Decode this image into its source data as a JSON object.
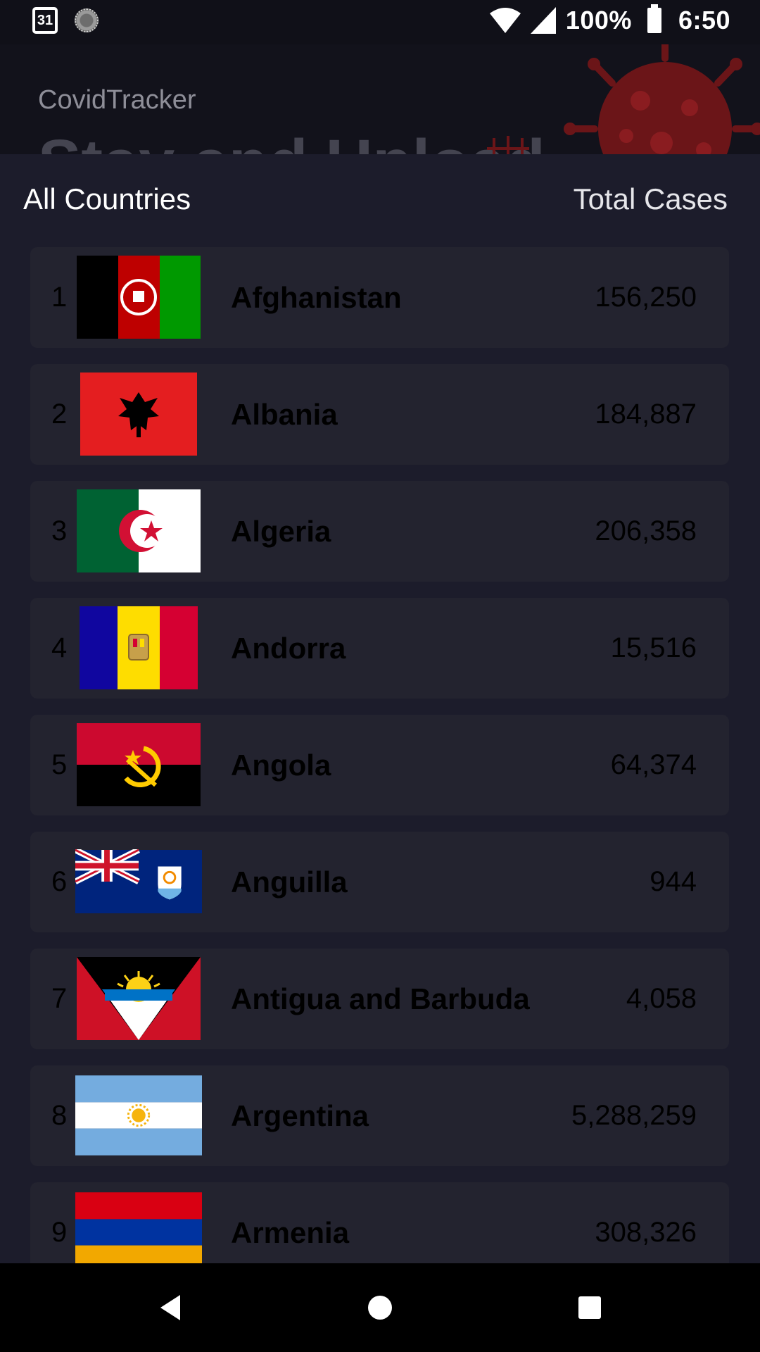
{
  "status_bar": {
    "calendar_day": "31",
    "battery_percent": "100%",
    "time": "6:50",
    "icons": [
      "calendar-icon",
      "sync-spinner-icon",
      "wifi-icon",
      "cell-signal-icon",
      "battery-icon"
    ]
  },
  "header": {
    "app_name": "CovidTracker",
    "background_title": "Stay and Upload",
    "decorations": [
      "virus-icon"
    ]
  },
  "list_header": {
    "left_label": "All Countries",
    "right_label": "Total Cases"
  },
  "countries": [
    {
      "rank": "1",
      "name": "Afghanistan",
      "cases": "156,250",
      "flag": "afghanistan-flag-icon"
    },
    {
      "rank": "2",
      "name": "Albania",
      "cases": "184,887",
      "flag": "albania-flag-icon"
    },
    {
      "rank": "3",
      "name": "Algeria",
      "cases": "206,358",
      "flag": "algeria-flag-icon"
    },
    {
      "rank": "4",
      "name": "Andorra",
      "cases": "15,516",
      "flag": "andorra-flag-icon"
    },
    {
      "rank": "5",
      "name": "Angola",
      "cases": "64,374",
      "flag": "angola-flag-icon"
    },
    {
      "rank": "6",
      "name": "Anguilla",
      "cases": "944",
      "flag": "anguilla-flag-icon"
    },
    {
      "rank": "7",
      "name": "Antigua and Barbuda",
      "cases": "4,058",
      "flag": "antigua-and-barbuda-flag-icon"
    },
    {
      "rank": "8",
      "name": "Argentina",
      "cases": "5,288,259",
      "flag": "argentina-flag-icon"
    },
    {
      "rank": "9",
      "name": "Armenia",
      "cases": "308,326",
      "flag": "armenia-flag-icon"
    }
  ],
  "nav_bar": {
    "icons": [
      "back-icon",
      "home-icon",
      "recents-icon"
    ]
  },
  "colors": {
    "panel_bg": "#1c1c2b",
    "row_bg": "#23232f",
    "header_bg": "#12121b",
    "virus_red": "#6b1518"
  }
}
